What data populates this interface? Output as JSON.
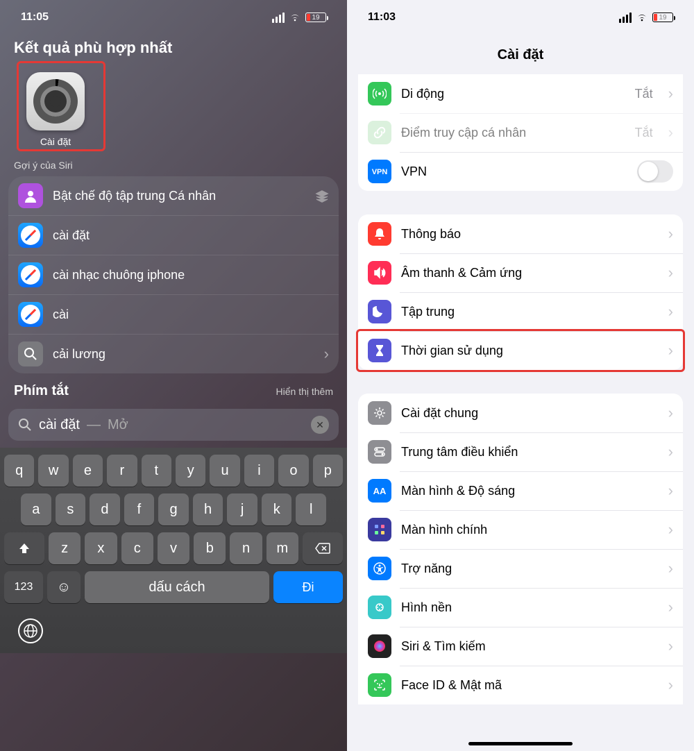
{
  "left": {
    "status_time": "11:05",
    "battery_pct": "19",
    "best_match_title": "Kết quả phù hợp nhất",
    "app_label": "Cài đặt",
    "siri_hint": "Gợi ý của Siri",
    "suggestions": [
      {
        "label": "Bật chế độ tập trung Cá nhân",
        "icon": "person-focus",
        "color": "purple",
        "trailing": "stack"
      },
      {
        "label": "cài đặt",
        "icon": "safari",
        "color": "safari",
        "trailing": "none"
      },
      {
        "label": "cài nhạc chuông iphone",
        "icon": "safari",
        "color": "safari",
        "trailing": "none"
      },
      {
        "label": "cài",
        "icon": "safari",
        "color": "safari",
        "trailing": "none"
      },
      {
        "label": "cải lương",
        "icon": "search",
        "color": "gray",
        "trailing": "chev"
      }
    ],
    "shortcuts_title": "Phím tắt",
    "shortcuts_more": "Hiển thị thêm",
    "search_query": "cài đặt",
    "search_hint_sep": " — ",
    "search_hint": "Mở",
    "keyboard": {
      "row1": [
        "q",
        "w",
        "e",
        "r",
        "t",
        "y",
        "u",
        "i",
        "o",
        "p"
      ],
      "row2": [
        "a",
        "s",
        "d",
        "f",
        "g",
        "h",
        "j",
        "k",
        "l"
      ],
      "row3": [
        "z",
        "x",
        "c",
        "v",
        "b",
        "n",
        "m"
      ],
      "num": "123",
      "space": "dấu cách",
      "go": "Đi"
    }
  },
  "right": {
    "status_time": "11:03",
    "battery_pct": "19",
    "title": "Cài đặt",
    "group1": [
      {
        "label": "Di động",
        "value": "Tắt",
        "icon": "antenna",
        "color": "#34c759",
        "style": "chev"
      },
      {
        "label": "Điểm truy cập cá nhân",
        "value": "Tắt",
        "icon": "link",
        "color": "#b8e4bd",
        "style": "chev",
        "disabled": true
      },
      {
        "label": "VPN",
        "value": "",
        "icon": "vpn",
        "color": "#007aff",
        "style": "toggle"
      }
    ],
    "group2": [
      {
        "label": "Thông báo",
        "icon": "bell",
        "color": "#ff3b30",
        "style": "chev"
      },
      {
        "label": "Âm thanh & Cảm ứng",
        "icon": "speaker",
        "color": "#ff2d55",
        "style": "chev"
      },
      {
        "label": "Tập trung",
        "icon": "moon",
        "color": "#5856d6",
        "style": "chev"
      },
      {
        "label": "Thời gian sử dụng",
        "icon": "hourglass",
        "color": "#5856d6",
        "style": "chev",
        "highlight": true
      }
    ],
    "group3": [
      {
        "label": "Cài đặt chung",
        "icon": "gear",
        "color": "#8e8e93",
        "style": "chev"
      },
      {
        "label": "Trung tâm điều khiển",
        "icon": "switches",
        "color": "#8e8e93",
        "style": "chev"
      },
      {
        "label": "Màn hình & Độ sáng",
        "icon": "textsize",
        "color": "#007aff",
        "style": "chev"
      },
      {
        "label": "Màn hình chính",
        "icon": "grid",
        "color": "#3a3a9e",
        "style": "chev"
      },
      {
        "label": "Trợ năng",
        "icon": "accessibility",
        "color": "#007aff",
        "style": "chev"
      },
      {
        "label": "Hình nền",
        "icon": "wallpaper",
        "color": "#38c9c9",
        "style": "chev"
      },
      {
        "label": "Siri & Tìm kiếm",
        "icon": "siri",
        "color": "#222",
        "style": "chev"
      },
      {
        "label": "Face ID & Mật mã",
        "icon": "faceid",
        "color": "#34c759",
        "style": "chev"
      }
    ]
  }
}
